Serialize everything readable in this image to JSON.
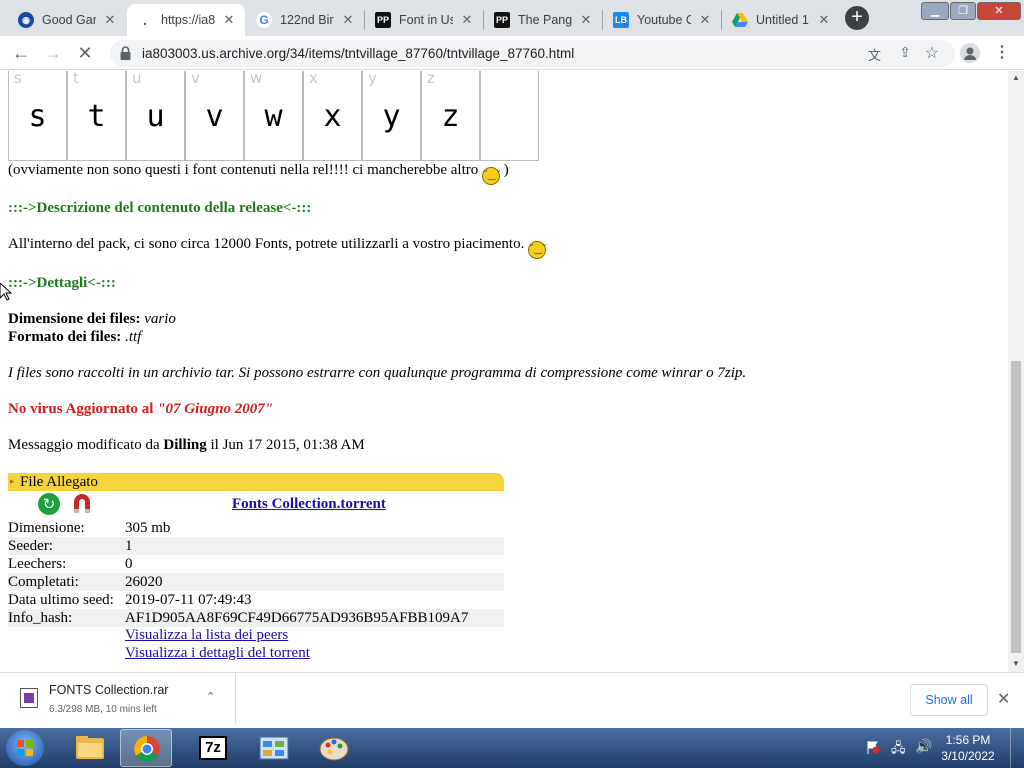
{
  "tabs": [
    {
      "label": "Good Gam",
      "favicon": "gamepad-icon"
    },
    {
      "label": "https://ia8",
      "favicon": "loading-icon"
    },
    {
      "label": "122nd Birt",
      "favicon": "google-icon"
    },
    {
      "label": "Font in Us",
      "favicon": "pp-icon"
    },
    {
      "label": "The Pango",
      "favicon": "pp-icon"
    },
    {
      "label": "Youtube C",
      "favicon": "lb-icon"
    },
    {
      "label": "Untitled 1",
      "favicon": "drive-icon"
    }
  ],
  "favicon_text": {
    "pp": "PP",
    "lb": "LB"
  },
  "address": {
    "url": "ia803003.us.archive.org/34/items/tntvillage_87760/tntvillage_87760.html"
  },
  "glyphs": [
    {
      "small": "s",
      "big": "s"
    },
    {
      "small": "t",
      "big": "t"
    },
    {
      "small": "u",
      "big": "u"
    },
    {
      "small": "v",
      "big": "v"
    },
    {
      "small": "w",
      "big": "w"
    },
    {
      "small": "x",
      "big": "x"
    },
    {
      "small": "y",
      "big": "y"
    },
    {
      "small": "z",
      "big": "z"
    },
    {
      "small": "",
      "big": ""
    }
  ],
  "page": {
    "note_prefix": "(ovviamente non sono questi i font contenuti nella rel!!!! ci mancherebbe altro ",
    "note_suffix": " )",
    "desc_pre": ":::->",
    "desc_title": "Descrizione del contenuto della release",
    "desc_post": "<-:::",
    "desc_text": "All'interno del pack, ci sono circa 12000 Fonts, potrete utilizzarli a vostro piacimento. ",
    "det_pre": ":::->",
    "det_title": "Dettagli",
    "det_post": "<-:::",
    "dim_label": "Dimensione dei files:",
    "dim_value": " vario",
    "fmt_label": "Formato dei files:",
    "fmt_value": " .ttf",
    "tar_text": "I files sono raccolti in un archivio tar. Si possono estrarre con qualunque programma di compressione come winrar o 7zip.",
    "virus_text": "No virus Aggiornato al ",
    "virus_date": "\"07 Giugno 2007\"",
    "msg_prefix": "Messaggio modificato da ",
    "msg_user": "Dilling",
    "msg_suffix": " il Jun 17 2015, 01:38 AM"
  },
  "attachment": {
    "header": "File Allegato",
    "torrent_link": "Fonts Collection.torrent",
    "rows": [
      {
        "k": "Dimensione:",
        "v": "305 mb"
      },
      {
        "k": "Seeder:",
        "v": "1"
      },
      {
        "k": "Leechers:",
        "v": "0"
      },
      {
        "k": "Completati:",
        "v": "26020"
      },
      {
        "k": "Data ultimo seed:",
        "v": "2019-07-11 07:49:43"
      },
      {
        "k": "Info_hash:",
        "v": "AF1D905AA8F69CF49D66775AD936B95AFBB109A7"
      }
    ],
    "link_peers": "Visualizza la lista dei peers",
    "link_details": "Visualizza i dettagli del torrent"
  },
  "download": {
    "filename": "FONTS Collection.rar",
    "progress": "6.3/298 MB, 10 mins left",
    "show_all": "Show all"
  },
  "taskbar": {
    "time": "1:56 PM",
    "date": "3/10/2022",
    "sevenzip_label": "7z"
  },
  "colors": {
    "heading_green": "#1f7a1f",
    "virus_red": "#d41a1a",
    "attachment_yellow": "#f5d43b",
    "link_blue": "#1a0dab"
  }
}
